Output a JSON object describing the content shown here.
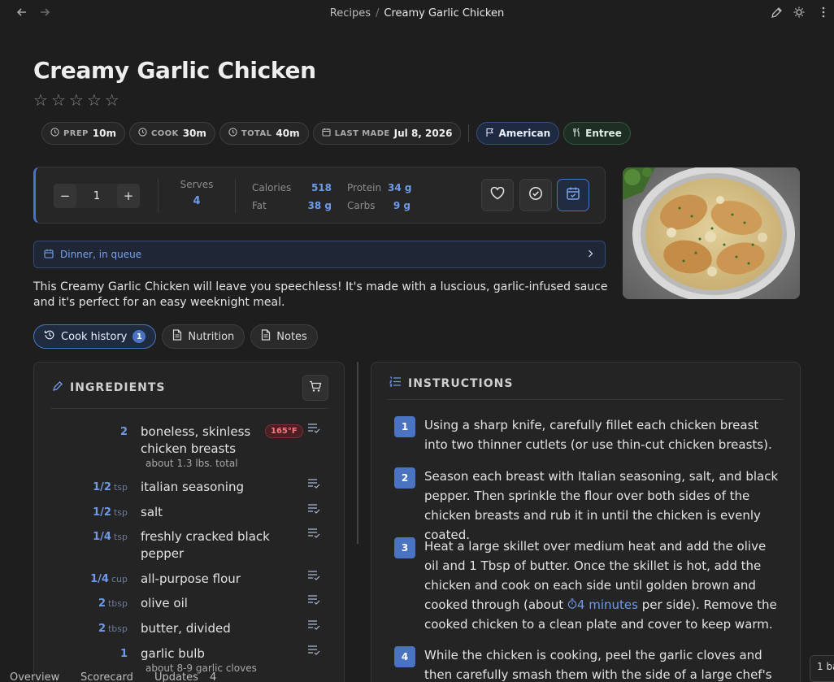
{
  "breadcrumb": {
    "parent": "Recipes",
    "separator": "/",
    "current": "Creamy Garlic Chicken"
  },
  "recipe": {
    "title": "Creamy Garlic Chicken",
    "rating": {
      "value": 0,
      "max": 5,
      "star_char": "☆"
    },
    "times": [
      {
        "label": "PREP",
        "value": "10m"
      },
      {
        "label": "COOK",
        "value": "30m"
      },
      {
        "label": "TOTAL",
        "value": "40m"
      },
      {
        "label": "LAST MADE",
        "value": "Jul 8, 2026"
      }
    ],
    "tags": [
      {
        "label": "American"
      },
      {
        "label": "Entree"
      }
    ],
    "description": "This Creamy Garlic Chicken will leave you speechless! It's made with a luscious, garlic-infused sauce and it's perfect for an easy weeknight meal."
  },
  "scaler": {
    "minus": "−",
    "quantity": "1",
    "plus": "+"
  },
  "serves": {
    "label": "Serves",
    "value": "4"
  },
  "nutrition": {
    "calories_label": "Calories",
    "calories": "518",
    "protein_label": "Protein",
    "protein": "34 g",
    "fat_label": "Fat",
    "fat": "38 g",
    "carbs_label": "Carbs",
    "carbs": "9 g"
  },
  "queue": {
    "label": "Dinner, in queue"
  },
  "tabs": [
    {
      "label": "Cook history",
      "badge": "1"
    },
    {
      "label": "Nutrition"
    },
    {
      "label": "Notes"
    }
  ],
  "ingredients": {
    "title": "INGREDIENTS",
    "items": [
      {
        "amount": "2",
        "unit": "",
        "name": "boneless, skinless chicken breasts",
        "note": "about 1.3 lbs. total",
        "badge": "165°F"
      },
      {
        "amount": "1/2",
        "unit": "tsp",
        "name": "italian seasoning"
      },
      {
        "amount": "1/2",
        "unit": "tsp",
        "name": "salt"
      },
      {
        "amount": "1/4",
        "unit": "tsp",
        "name": "freshly cracked black pepper"
      },
      {
        "amount": "1/4",
        "unit": "cup",
        "name": "all-purpose flour"
      },
      {
        "amount": "2",
        "unit": "tbsp",
        "name": "olive oil"
      },
      {
        "amount": "2",
        "unit": "tbsp",
        "name": "butter, divided"
      },
      {
        "amount": "1",
        "unit": "",
        "name": "garlic bulb",
        "note": "about 8-9 garlic cloves"
      }
    ]
  },
  "instructions": {
    "title": "INSTRUCTIONS",
    "steps": [
      {
        "num": "1",
        "text": "Using a sharp knife, carefully fillet each chicken breast into two thinner cutlets (or use thin-cut chicken breasts)."
      },
      {
        "num": "2",
        "text": "Season each breast with Italian seasoning, salt, and black pepper. Then sprinkle the flour over both sides of the chicken breasts and rub it in until the chicken is evenly coated."
      },
      {
        "num": "3",
        "text_before": "Heat a large skillet over medium heat and add the olive oil and 1 Tbsp of butter. Once the skillet is hot, add the chicken and cook on each side until golden brown and cooked through (about ",
        "timer": "4 minutes",
        "text_after": " per side). Remove the cooked chicken to a clean plate and cover to keep warm."
      },
      {
        "num": "4",
        "text": "While the chicken is cooking, peel the garlic cloves and then carefully smash them with the side of a large chef's knife by"
      }
    ]
  },
  "bottom_tabs": [
    "Overview",
    "Scorecard",
    "Updates",
    "4"
  ],
  "corner_text": "1 ba",
  "colors": {
    "accent": "#4a74c2",
    "accent_text": "#6f9ae8",
    "bg": "#1e1e1f"
  }
}
